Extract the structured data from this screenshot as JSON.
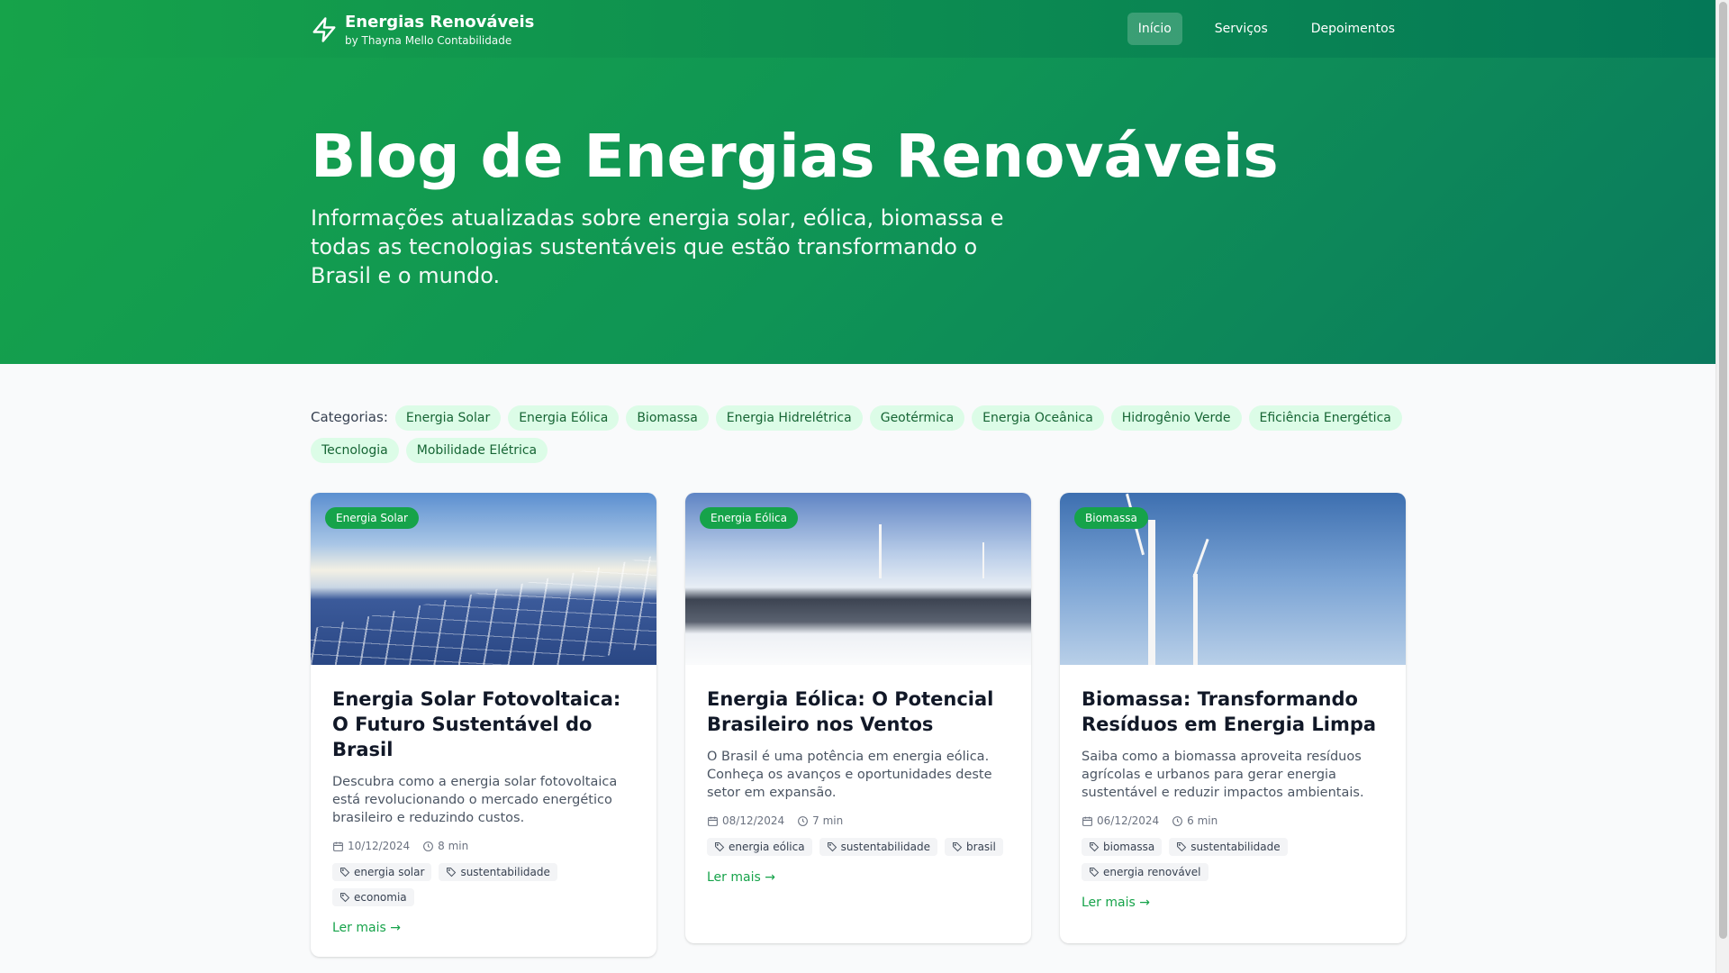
{
  "header": {
    "title": "Energias Renováveis",
    "subtitle": "by Thayna Mello Contabilidade",
    "nav": [
      "Início",
      "Serviços",
      "Depoimentos"
    ]
  },
  "hero": {
    "title": "Blog de Energias Renováveis",
    "subtitle": "Informações atualizadas sobre energia solar, eólica, biomassa e todas as tecnologias sustentáveis que estão transformando o Brasil e o mundo."
  },
  "categories": {
    "label": "Categorias:",
    "items": [
      "Energia Solar",
      "Energia Eólica",
      "Biomassa",
      "Energia Hidrelétrica",
      "Geotérmica",
      "Energia Oceânica",
      "Hidrogênio Verde",
      "Eficiência Energética",
      "Tecnologia",
      "Mobilidade Elétrica"
    ]
  },
  "posts": [
    {
      "badge": "Energia Solar",
      "title": "Energia Solar Fotovoltaica: O Futuro Sustentável do Brasil",
      "desc": "Descubra como a energia solar fotovoltaica está revolucionando o mercado energético brasileiro e reduzindo custos.",
      "date": "10/12/2024",
      "read": "8 min",
      "tags": [
        "energia solar",
        "sustentabilidade",
        "economia"
      ],
      "link": "Ler mais →"
    },
    {
      "badge": "Energia Eólica",
      "title": "Energia Eólica: O Potencial Brasileiro nos Ventos",
      "desc": "O Brasil é uma potência em energia eólica. Conheça os avanços e oportunidades deste setor em expansão.",
      "date": "08/12/2024",
      "read": "7 min",
      "tags": [
        "energia eólica",
        "sustentabilidade",
        "brasil"
      ],
      "link": "Ler mais →"
    },
    {
      "badge": "Biomassa",
      "title": "Biomassa: Transformando Resíduos em Energia Limpa",
      "desc": "Saiba como a biomassa aproveita resíduos agrícolas e urbanos para gerar energia sustentável e reduzir impactos ambientais.",
      "date": "06/12/2024",
      "read": "6 min",
      "tags": [
        "biomassa",
        "sustentabilidade",
        "energia renovável"
      ],
      "link": "Ler mais →"
    }
  ]
}
